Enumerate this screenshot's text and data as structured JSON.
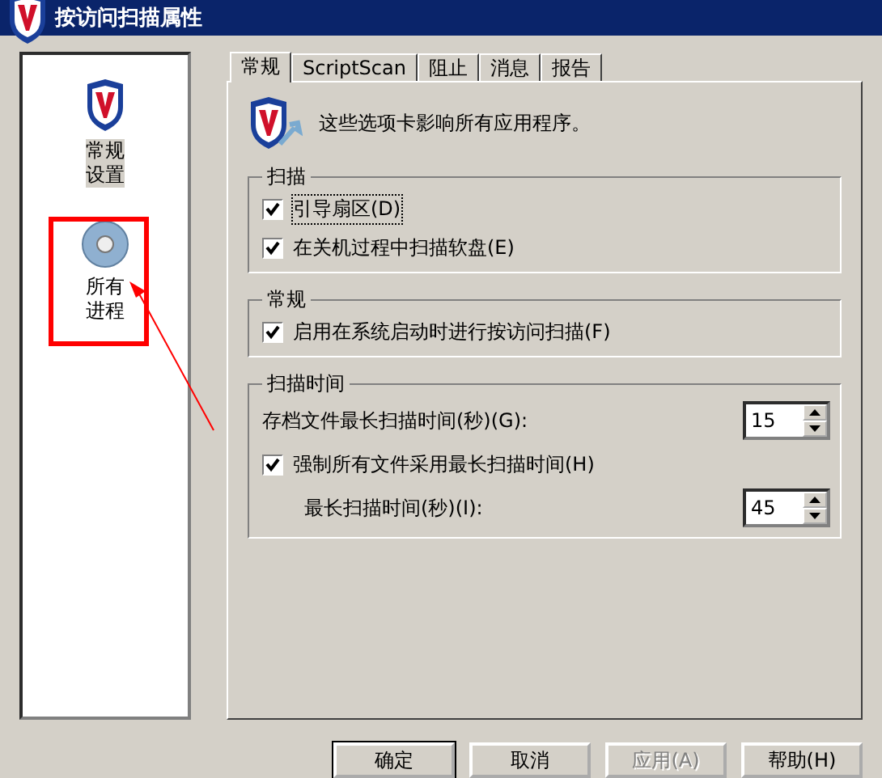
{
  "window": {
    "title": "按访问扫描属性"
  },
  "sidebar": {
    "items": [
      {
        "label": "常规设置",
        "kind": "shield",
        "selected": true
      },
      {
        "label": "所有进程",
        "kind": "disc",
        "selected": false
      }
    ]
  },
  "annotation": {
    "kind": "arrow-box"
  },
  "tabs": [
    {
      "label": "常规",
      "selected": true
    },
    {
      "label": "ScriptScan",
      "selected": false
    },
    {
      "label": "阻止",
      "selected": false
    },
    {
      "label": "消息",
      "selected": false
    },
    {
      "label": "报告",
      "selected": false
    }
  ],
  "intro": "这些选项卡影响所有应用程序。",
  "groups": [
    {
      "title": "扫描",
      "items": [
        {
          "kind": "checkbox",
          "label": "引导扇区(D)",
          "checked": true,
          "focused": true
        },
        {
          "kind": "checkbox",
          "label": "在关机过程中扫描软盘(E)",
          "checked": true
        }
      ]
    },
    {
      "title": "常规",
      "items": [
        {
          "kind": "checkbox",
          "label": "启用在系统启动时进行按访问扫描(F)",
          "checked": true
        }
      ]
    },
    {
      "title": "扫描时间",
      "items": [
        {
          "kind": "spinner",
          "label": "存档文件最长扫描时间(秒)(G):",
          "value": "15"
        },
        {
          "kind": "checkbox",
          "label": "强制所有文件采用最长扫描时间(H)",
          "checked": true
        },
        {
          "kind": "spinner",
          "label": "最长扫描时间(秒)(I):",
          "value": "45",
          "indent": true
        }
      ]
    }
  ],
  "buttons": [
    {
      "label": "确定",
      "default": true,
      "disabled": false
    },
    {
      "label": "取消",
      "default": false,
      "disabled": false
    },
    {
      "label": "应用(A)",
      "default": false,
      "disabled": true
    },
    {
      "label": "帮助(H)",
      "default": false,
      "disabled": false
    }
  ]
}
